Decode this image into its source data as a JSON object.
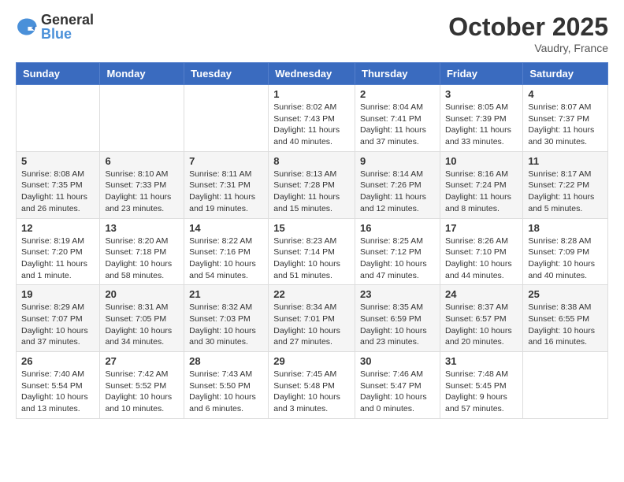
{
  "header": {
    "logo_general": "General",
    "logo_blue": "Blue",
    "month_title": "October 2025",
    "location": "Vaudry, France"
  },
  "weekdays": [
    "Sunday",
    "Monday",
    "Tuesday",
    "Wednesday",
    "Thursday",
    "Friday",
    "Saturday"
  ],
  "weeks": [
    [
      {
        "day": "",
        "info": ""
      },
      {
        "day": "",
        "info": ""
      },
      {
        "day": "",
        "info": ""
      },
      {
        "day": "1",
        "info": "Sunrise: 8:02 AM\nSunset: 7:43 PM\nDaylight: 11 hours and 40 minutes."
      },
      {
        "day": "2",
        "info": "Sunrise: 8:04 AM\nSunset: 7:41 PM\nDaylight: 11 hours and 37 minutes."
      },
      {
        "day": "3",
        "info": "Sunrise: 8:05 AM\nSunset: 7:39 PM\nDaylight: 11 hours and 33 minutes."
      },
      {
        "day": "4",
        "info": "Sunrise: 8:07 AM\nSunset: 7:37 PM\nDaylight: 11 hours and 30 minutes."
      }
    ],
    [
      {
        "day": "5",
        "info": "Sunrise: 8:08 AM\nSunset: 7:35 PM\nDaylight: 11 hours and 26 minutes."
      },
      {
        "day": "6",
        "info": "Sunrise: 8:10 AM\nSunset: 7:33 PM\nDaylight: 11 hours and 23 minutes."
      },
      {
        "day": "7",
        "info": "Sunrise: 8:11 AM\nSunset: 7:31 PM\nDaylight: 11 hours and 19 minutes."
      },
      {
        "day": "8",
        "info": "Sunrise: 8:13 AM\nSunset: 7:28 PM\nDaylight: 11 hours and 15 minutes."
      },
      {
        "day": "9",
        "info": "Sunrise: 8:14 AM\nSunset: 7:26 PM\nDaylight: 11 hours and 12 minutes."
      },
      {
        "day": "10",
        "info": "Sunrise: 8:16 AM\nSunset: 7:24 PM\nDaylight: 11 hours and 8 minutes."
      },
      {
        "day": "11",
        "info": "Sunrise: 8:17 AM\nSunset: 7:22 PM\nDaylight: 11 hours and 5 minutes."
      }
    ],
    [
      {
        "day": "12",
        "info": "Sunrise: 8:19 AM\nSunset: 7:20 PM\nDaylight: 11 hours and 1 minute."
      },
      {
        "day": "13",
        "info": "Sunrise: 8:20 AM\nSunset: 7:18 PM\nDaylight: 10 hours and 58 minutes."
      },
      {
        "day": "14",
        "info": "Sunrise: 8:22 AM\nSunset: 7:16 PM\nDaylight: 10 hours and 54 minutes."
      },
      {
        "day": "15",
        "info": "Sunrise: 8:23 AM\nSunset: 7:14 PM\nDaylight: 10 hours and 51 minutes."
      },
      {
        "day": "16",
        "info": "Sunrise: 8:25 AM\nSunset: 7:12 PM\nDaylight: 10 hours and 47 minutes."
      },
      {
        "day": "17",
        "info": "Sunrise: 8:26 AM\nSunset: 7:10 PM\nDaylight: 10 hours and 44 minutes."
      },
      {
        "day": "18",
        "info": "Sunrise: 8:28 AM\nSunset: 7:09 PM\nDaylight: 10 hours and 40 minutes."
      }
    ],
    [
      {
        "day": "19",
        "info": "Sunrise: 8:29 AM\nSunset: 7:07 PM\nDaylight: 10 hours and 37 minutes."
      },
      {
        "day": "20",
        "info": "Sunrise: 8:31 AM\nSunset: 7:05 PM\nDaylight: 10 hours and 34 minutes."
      },
      {
        "day": "21",
        "info": "Sunrise: 8:32 AM\nSunset: 7:03 PM\nDaylight: 10 hours and 30 minutes."
      },
      {
        "day": "22",
        "info": "Sunrise: 8:34 AM\nSunset: 7:01 PM\nDaylight: 10 hours and 27 minutes."
      },
      {
        "day": "23",
        "info": "Sunrise: 8:35 AM\nSunset: 6:59 PM\nDaylight: 10 hours and 23 minutes."
      },
      {
        "day": "24",
        "info": "Sunrise: 8:37 AM\nSunset: 6:57 PM\nDaylight: 10 hours and 20 minutes."
      },
      {
        "day": "25",
        "info": "Sunrise: 8:38 AM\nSunset: 6:55 PM\nDaylight: 10 hours and 16 minutes."
      }
    ],
    [
      {
        "day": "26",
        "info": "Sunrise: 7:40 AM\nSunset: 5:54 PM\nDaylight: 10 hours and 13 minutes."
      },
      {
        "day": "27",
        "info": "Sunrise: 7:42 AM\nSunset: 5:52 PM\nDaylight: 10 hours and 10 minutes."
      },
      {
        "day": "28",
        "info": "Sunrise: 7:43 AM\nSunset: 5:50 PM\nDaylight: 10 hours and 6 minutes."
      },
      {
        "day": "29",
        "info": "Sunrise: 7:45 AM\nSunset: 5:48 PM\nDaylight: 10 hours and 3 minutes."
      },
      {
        "day": "30",
        "info": "Sunrise: 7:46 AM\nSunset: 5:47 PM\nDaylight: 10 hours and 0 minutes."
      },
      {
        "day": "31",
        "info": "Sunrise: 7:48 AM\nSunset: 5:45 PM\nDaylight: 9 hours and 57 minutes."
      },
      {
        "day": "",
        "info": ""
      }
    ]
  ]
}
